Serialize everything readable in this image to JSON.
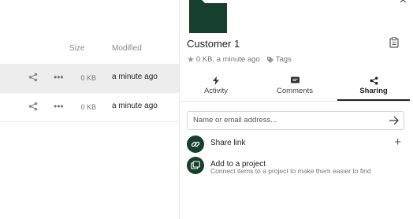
{
  "files": {
    "columns": {
      "size": "Size",
      "modified": "Modified"
    },
    "rows": [
      {
        "size": "0 KB",
        "modified": "a minute ago",
        "more": "•••"
      },
      {
        "size": "0 KB",
        "modified": "a minute ago",
        "more": "•••"
      }
    ]
  },
  "sidebar": {
    "close": "×",
    "title": "Customer 1",
    "meta": {
      "size_time": "0 KB, a minute ago",
      "tags": "Tags"
    },
    "tabs": [
      {
        "label": "Activity",
        "icon": "bolt-icon"
      },
      {
        "label": "Comments",
        "icon": "comment-icon"
      },
      {
        "label": "Sharing",
        "icon": "share-icon"
      }
    ],
    "active_tab": "Sharing",
    "share_input": {
      "placeholder": "Name or email address..."
    },
    "share_link": {
      "label": "Share link",
      "action": "+"
    },
    "project": {
      "label": "Add to a project",
      "description": "Connect items to a project to make them easier to find"
    }
  },
  "colors": {
    "accent": "#15402d",
    "selected_row": "#ededed"
  }
}
